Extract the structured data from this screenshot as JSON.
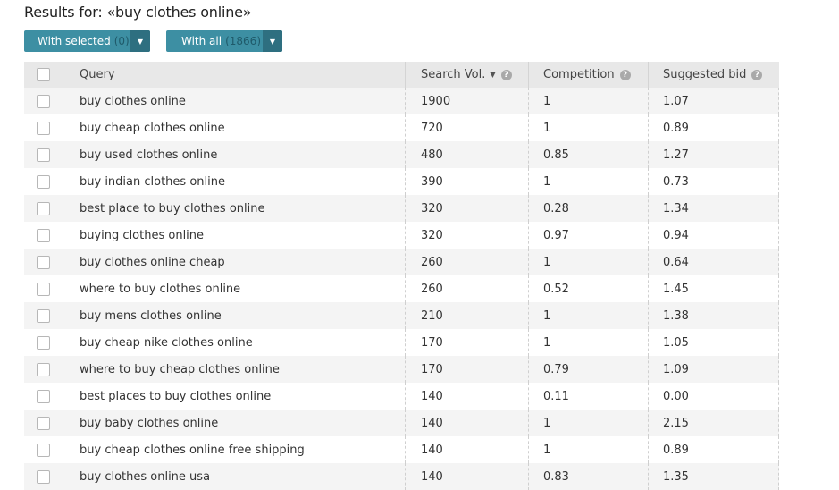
{
  "heading": "Results for: «buy clothes online»",
  "buttons": {
    "with_selected": {
      "label": "With selected",
      "count": "(0)"
    },
    "with_all": {
      "label": "With all",
      "count": "(1866)"
    }
  },
  "table": {
    "headers": {
      "query": "Query",
      "search_vol": "Search Vol.",
      "competition": "Competition",
      "suggested_bid": "Suggested bid"
    },
    "rows": [
      {
        "query": "buy clothes online",
        "volume": "1900",
        "competition": "1",
        "bid": "1.07"
      },
      {
        "query": "buy cheap clothes online",
        "volume": "720",
        "competition": "1",
        "bid": "0.89"
      },
      {
        "query": "buy used clothes online",
        "volume": "480",
        "competition": "0.85",
        "bid": "1.27"
      },
      {
        "query": "buy indian clothes online",
        "volume": "390",
        "competition": "1",
        "bid": "0.73"
      },
      {
        "query": "best place to buy clothes online",
        "volume": "320",
        "competition": "0.28",
        "bid": "1.34"
      },
      {
        "query": "buying clothes online",
        "volume": "320",
        "competition": "0.97",
        "bid": "0.94"
      },
      {
        "query": "buy clothes online cheap",
        "volume": "260",
        "competition": "1",
        "bid": "0.64"
      },
      {
        "query": "where to buy clothes online",
        "volume": "260",
        "competition": "0.52",
        "bid": "1.45"
      },
      {
        "query": "buy mens clothes online",
        "volume": "210",
        "competition": "1",
        "bid": "1.38"
      },
      {
        "query": "buy cheap nike clothes online",
        "volume": "170",
        "competition": "1",
        "bid": "1.05"
      },
      {
        "query": "where to buy cheap clothes online",
        "volume": "170",
        "competition": "0.79",
        "bid": "1.09"
      },
      {
        "query": "best places to buy clothes online",
        "volume": "140",
        "competition": "0.11",
        "bid": "0.00"
      },
      {
        "query": "buy baby clothes online",
        "volume": "140",
        "competition": "1",
        "bid": "2.15"
      },
      {
        "query": "buy cheap clothes online free shipping",
        "volume": "140",
        "competition": "1",
        "bid": "0.89"
      },
      {
        "query": "buy clothes online usa",
        "volume": "140",
        "competition": "0.83",
        "bid": "1.35"
      }
    ]
  }
}
